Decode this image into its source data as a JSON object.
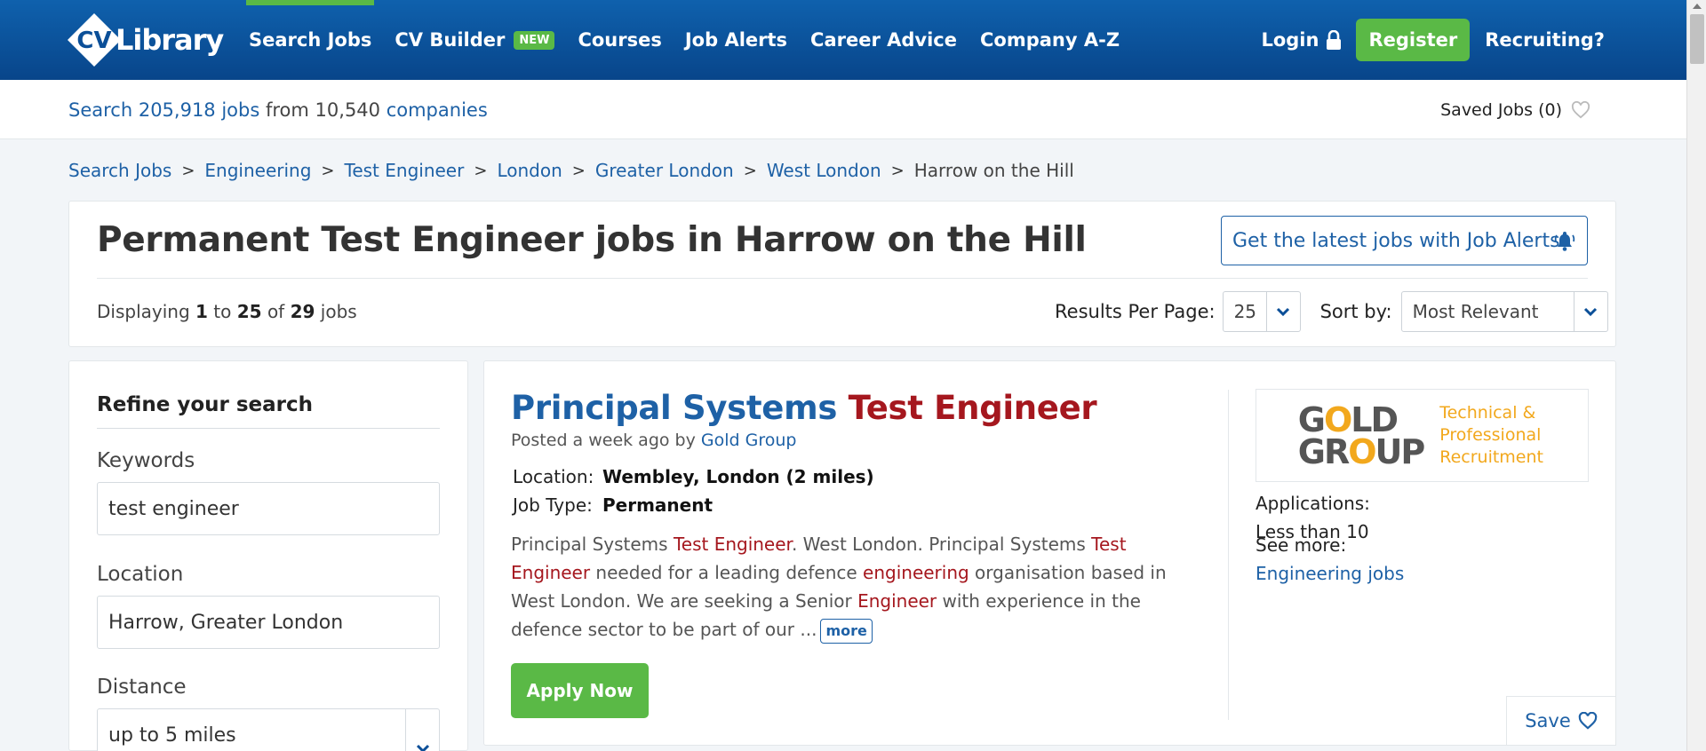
{
  "header": {
    "logo_text": "Library",
    "nav": [
      {
        "label": "Search Jobs"
      },
      {
        "label": "CV Builder",
        "badge": "NEW"
      },
      {
        "label": "Courses"
      },
      {
        "label": "Job Alerts"
      },
      {
        "label": "Career Advice"
      },
      {
        "label": "Company A-Z"
      }
    ],
    "login": "Login",
    "register": "Register",
    "recruiting": "Recruiting?"
  },
  "stats": {
    "prefix": "Search ",
    "jobs_count": "205,918 jobs",
    "middle": " from ",
    "companies_count": "10,540",
    "companies_word": " companies",
    "saved_jobs": "Saved Jobs (0)"
  },
  "breadcrumb": [
    "Search Jobs",
    "Engineering",
    "Test Engineer",
    "London",
    "Greater London",
    "West London",
    "Harrow on the Hill"
  ],
  "results": {
    "title": "Permanent Test Engineer jobs in Harrow on the Hill",
    "alerts_button": "Get the latest jobs with Job Alerts",
    "displaying": "Displaying",
    "from": "1",
    "to_word": "to",
    "to": "25",
    "of_word": "of",
    "total": "29",
    "jobs_word": "jobs",
    "per_page_label": "Results Per Page:",
    "per_page_value": "25",
    "sort_label": "Sort by:",
    "sort_value": "Most Relevant"
  },
  "sidebar": {
    "heading": "Refine your search",
    "keywords_label": "Keywords",
    "keywords_value": "test engineer",
    "location_label": "Location",
    "location_value": "Harrow, Greater London",
    "distance_label": "Distance",
    "distance_value": "up to 5 miles"
  },
  "job": {
    "title_a": "Principal Systems",
    "title_b": "Test Engineer",
    "posted_prefix": "Posted a week ago by",
    "company": "Gold Group",
    "location_label": "Location:",
    "location_value": "Wembley, London (2 miles)",
    "type_label": "Job Type:",
    "type_value": "Permanent",
    "desc_1": "Principal Systems ",
    "desc_hl1": "Test Engineer",
    "desc_2": ". West London. Principal Systems ",
    "desc_hl2": "Test Engineer",
    "desc_3": " needed for a leading defence ",
    "desc_hl3": "engineering",
    "desc_4": " organisation based in West London. We are seeking a Senior ",
    "desc_hl4": "Engineer",
    "desc_5": " with experience in the defence sector to be part of our ...",
    "more": "more",
    "apply": "Apply Now",
    "logo_line1": "G",
    "logo_o": "O",
    "logo_line1b": "LD",
    "logo_line2": "GR",
    "logo_line2b": "UP",
    "logo_tag": "Technical & Professional Recruitment",
    "applications_label": "Applications:",
    "applications_value": "Less than 10",
    "see_more_label": "See more:",
    "see_more_link": "Engineering jobs",
    "save": "Save"
  },
  "colors": {
    "brand_blue": "#0f61ad",
    "green": "#5ab946",
    "highlight_red": "#a5171e"
  }
}
